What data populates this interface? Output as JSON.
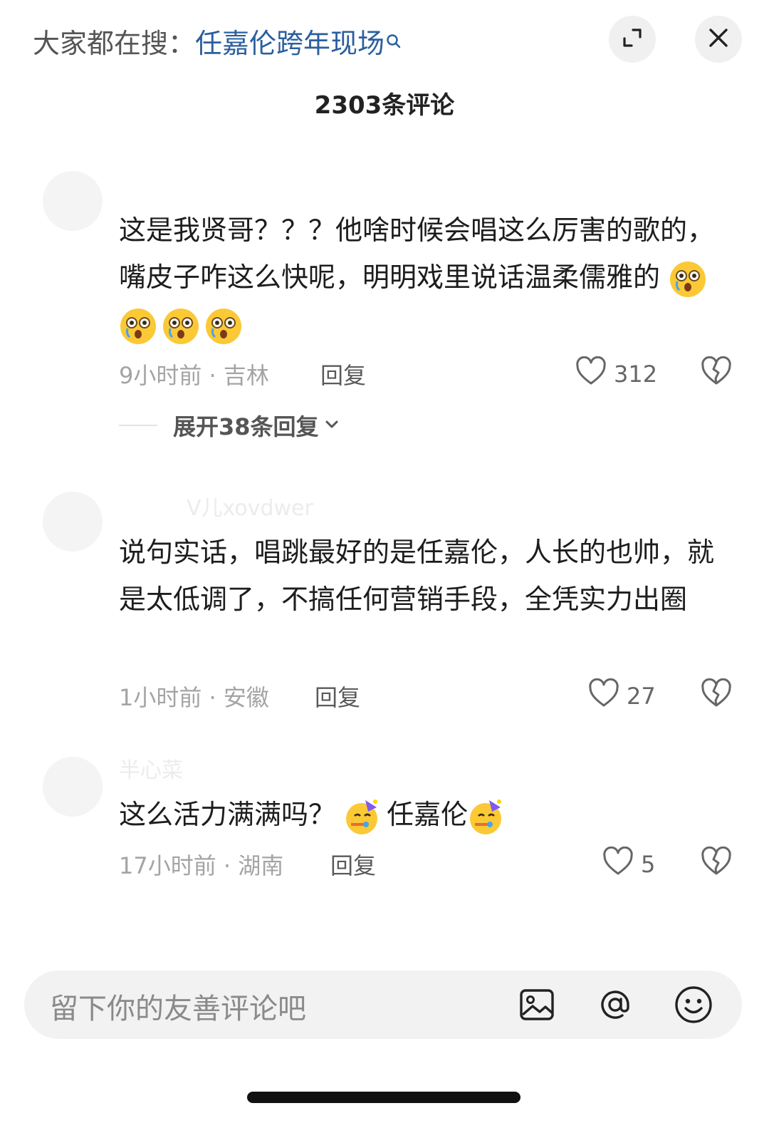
{
  "header": {
    "search_prefix": "大家都在搜：",
    "search_term": "任嘉伦跨年现场",
    "comment_count": "2303条评论"
  },
  "comments": [
    {
      "text": "这是我贤哥？？？他啥时候会唱这么厉害的歌的，嘴皮子咋这么快呢，明明戏里说话温柔儒雅的",
      "time_location": "9小时前 · 吉林",
      "reply_label": "回复",
      "likes": "312"
    },
    {
      "username": "V儿xovdwer",
      "text": "说句实话，唱跳最好的是任嘉伦，人长的也帅，就是太低调了，不搞任何营销手段，全凭实力出圈",
      "time_location": "1小时前 · 安徽",
      "reply_label": "回复",
      "likes": "27"
    },
    {
      "username": "半心菜",
      "text_part1": "这么活力满满吗？",
      "text_part2": "任嘉伦",
      "time_location": "17小时前 · 湖南",
      "reply_label": "回复",
      "likes": "5"
    }
  ],
  "expand_replies_label": "展开38条回复",
  "input": {
    "placeholder": "留下你的友善评论吧"
  },
  "icons": {
    "search": "search-icon",
    "expand": "expand-icon",
    "close": "close-icon",
    "heart": "heart-icon",
    "dislike": "broken-heart-icon",
    "image": "image-icon",
    "at": "at-icon",
    "emoji": "smiley-icon",
    "surprised_emoji": "surprised-face-emoji",
    "party_emoji": "party-face-emoji"
  },
  "colors": {
    "link": "#2b5f9e",
    "meta": "#a4a4a4"
  }
}
